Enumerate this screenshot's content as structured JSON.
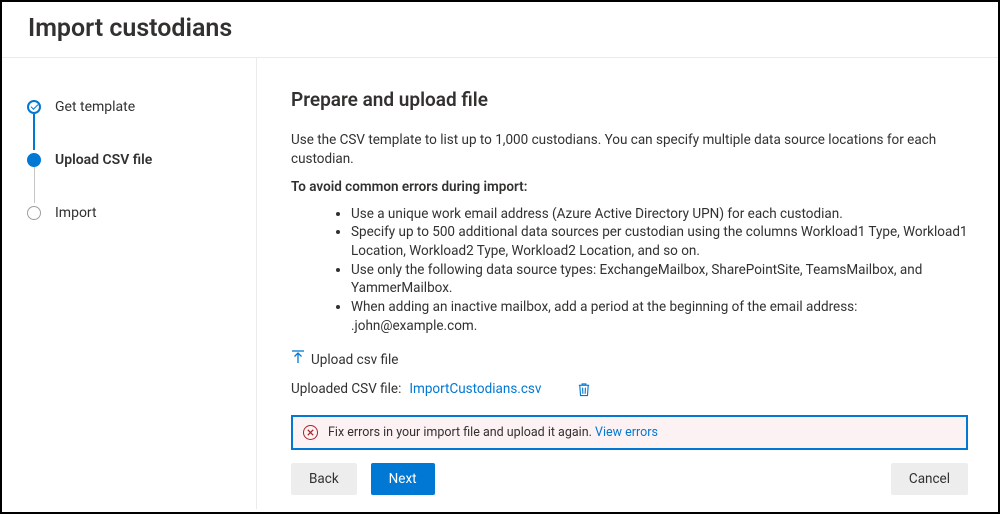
{
  "header": {
    "title": "Import custodians"
  },
  "steps": [
    {
      "label": "Get template"
    },
    {
      "label": "Upload CSV file"
    },
    {
      "label": "Import"
    }
  ],
  "main": {
    "heading": "Prepare and upload file",
    "lead": "Use the CSV template to list up to 1,000 custodians. You can specify multiple data source locations for each custodian.",
    "rules_intro": "To avoid common errors during import:",
    "rules": [
      "Use a unique work email address (Azure Active Directory UPN) for each custodian.",
      "Specify up to 500 additional data sources per custodian using the columns Workload1 Type, Workload1 Location, Workload2 Type, Workload2 Location, and so on.",
      "Use only the following data source types: ExchangeMailbox, SharePointSite, TeamsMailbox, and YammerMailbox.",
      "When adding an inactive mailbox, add a period at the beginning of the email address: .john@example.com."
    ],
    "upload_label": "Upload csv file",
    "uploaded_label": "Uploaded CSV file:",
    "uploaded_filename": "ImportCustodians.csv",
    "error_message": "Fix errors in your import file and upload it again. ",
    "error_link": "View errors"
  },
  "footer": {
    "back": "Back",
    "next": "Next",
    "cancel": "Cancel"
  }
}
